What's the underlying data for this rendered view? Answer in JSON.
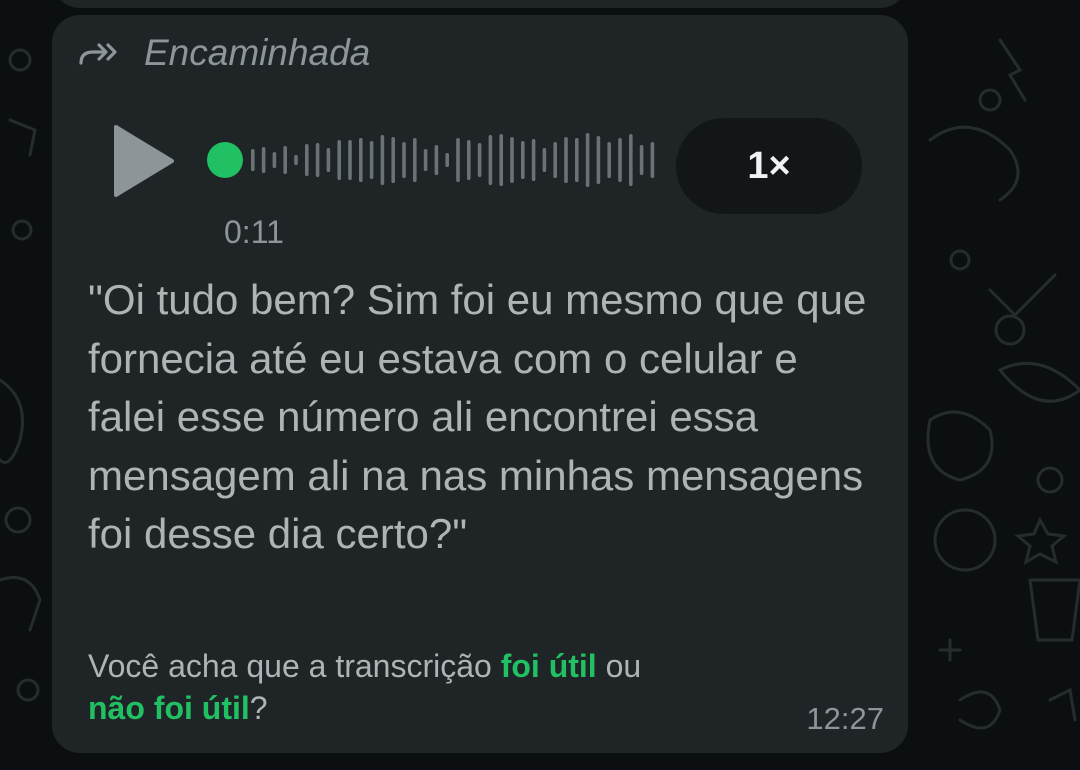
{
  "message": {
    "forwarded_label": "Encaminhada",
    "speed": "1×",
    "duration": "0:11",
    "transcript": "\"Oi tudo bem? Sim foi eu mesmo que que fornecia até eu estava com o celular e falei esse número ali encontrei essa mensagem ali na nas minhas mensagens foi desse dia certo?\"",
    "feedback": {
      "prefix": "Você acha que a transcrição ",
      "useful": "foi útil",
      "middle": " ou",
      "not_useful": "não foi útil",
      "suffix": "?"
    },
    "timestamp": "12:27"
  },
  "icons": {
    "forward": "forward-icon",
    "play": "play-icon",
    "progress": "playback-position-dot"
  },
  "colors": {
    "background": "#0b0f11",
    "bubble": "#1f2427",
    "accent_green": "#21c063",
    "speed_pill": "#121618",
    "text": "#aeb3b5",
    "muted": "#8d9598"
  }
}
